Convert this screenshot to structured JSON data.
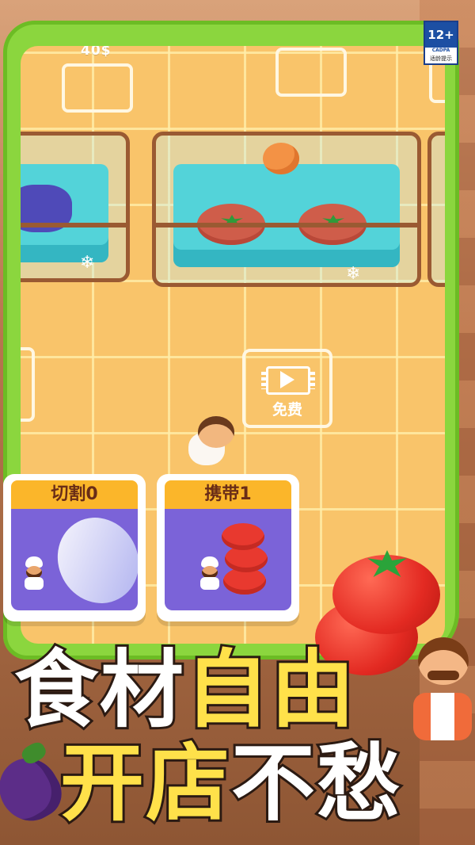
{
  "rating_badge": {
    "age": "12+",
    "org": "CADPA",
    "note": "适龄提示"
  },
  "floor": {
    "slot_price": "40$"
  },
  "video_button": {
    "label": "免费",
    "icon": "video-play-icon"
  },
  "upgrade_cards": [
    {
      "label": "切割0",
      "icon": "knife-slash-icon"
    },
    {
      "label": "携带1",
      "icon": "tomato-stack-icon"
    }
  ],
  "slogan": {
    "line1_white": "食材",
    "line1_gold": "自由",
    "line2_gold": "开店",
    "line2_white": "不愁"
  },
  "colors": {
    "frame_green": "#8bd63e",
    "floor_orange": "#f9c46a",
    "card_header": "#fbb62a",
    "card_panel": "#7b63d8"
  }
}
